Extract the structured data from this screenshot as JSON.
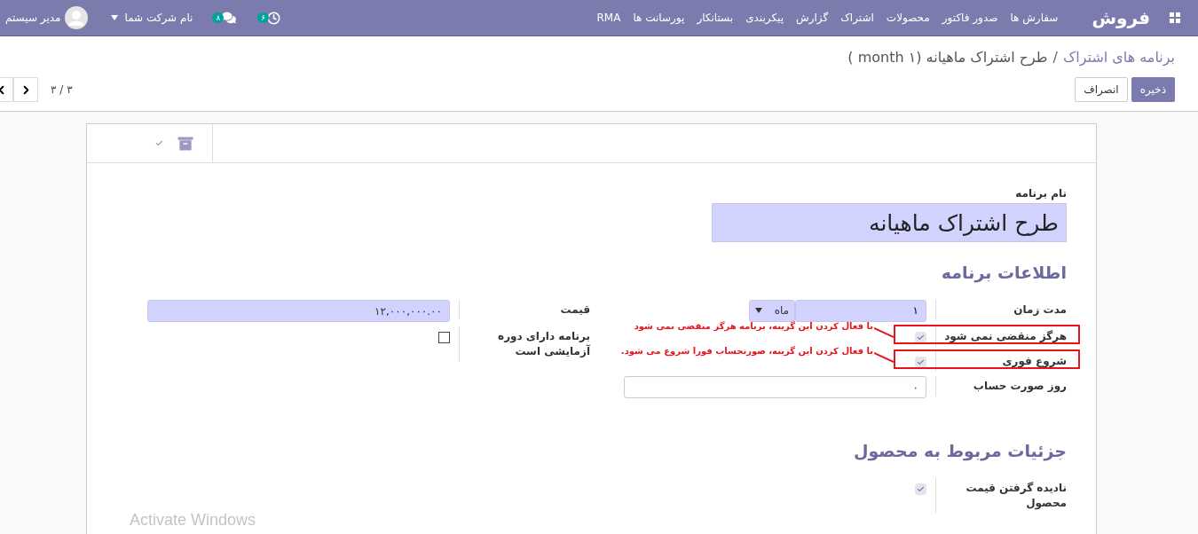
{
  "navbar": {
    "brand": "فروش",
    "menu": [
      {
        "label": "سفارش ها"
      },
      {
        "label": "صدور فاکتور"
      },
      {
        "label": "محصولات"
      },
      {
        "label": "اشتراک"
      },
      {
        "label": "گزارش"
      },
      {
        "label": "پیکربندی"
      },
      {
        "label": "بستانکار"
      },
      {
        "label": "پورسانت ها"
      },
      {
        "label": "RMA"
      }
    ],
    "activities_count": "۶",
    "messages_count": "۸",
    "company": "نام شرکت شما",
    "user": "مدیر سیستم"
  },
  "breadcrumb": {
    "parent": "برنامه های اشتراک",
    "separator": "/",
    "current": "طرح اشتراک ماهیانه (۱ month )"
  },
  "actions": {
    "save": "ذخیره",
    "discard": "انصراف"
  },
  "pager": {
    "counter": "۳ / ۳"
  },
  "sheet": {
    "name_label": "نام برنامه",
    "name_value": "طرح اشتراک ماهیانه",
    "sections": [
      {
        "title": "اطلاعات برنامه",
        "columns": [
          [
            {
              "kind": "duration",
              "label": "مدت زمان",
              "value": "۱",
              "unit": "ماه",
              "required": true
            },
            {
              "kind": "checkbox",
              "label": "هرگز منقضی نمی شود",
              "checked": true,
              "annotation": "با فعال کردن این گزینه، برنامه هرگز منقضی نمی شود"
            },
            {
              "kind": "checkbox",
              "label": "شروع فوری",
              "checked": true,
              "annotation": "با فعال کردن این گزینه، صورتحساب فورا شروع می شود."
            },
            {
              "kind": "input",
              "label": "روز صورت حساب",
              "value": "۰",
              "required": false
            }
          ],
          [
            {
              "kind": "input",
              "label": "قیمت",
              "value": "۱۲,۰۰۰,۰۰۰.۰۰",
              "required": true
            },
            {
              "kind": "checkbox",
              "label": "برنامه دارای دوره آزمایشی است",
              "checked": false
            }
          ]
        ]
      },
      {
        "title": "جزئیات مربوط به محصول",
        "columns": [
          [
            {
              "kind": "checkbox",
              "label": "نادیده گرفتن قیمت محصول",
              "checked": true
            }
          ]
        ]
      }
    ]
  },
  "os_overlay": "Activate Windows"
}
